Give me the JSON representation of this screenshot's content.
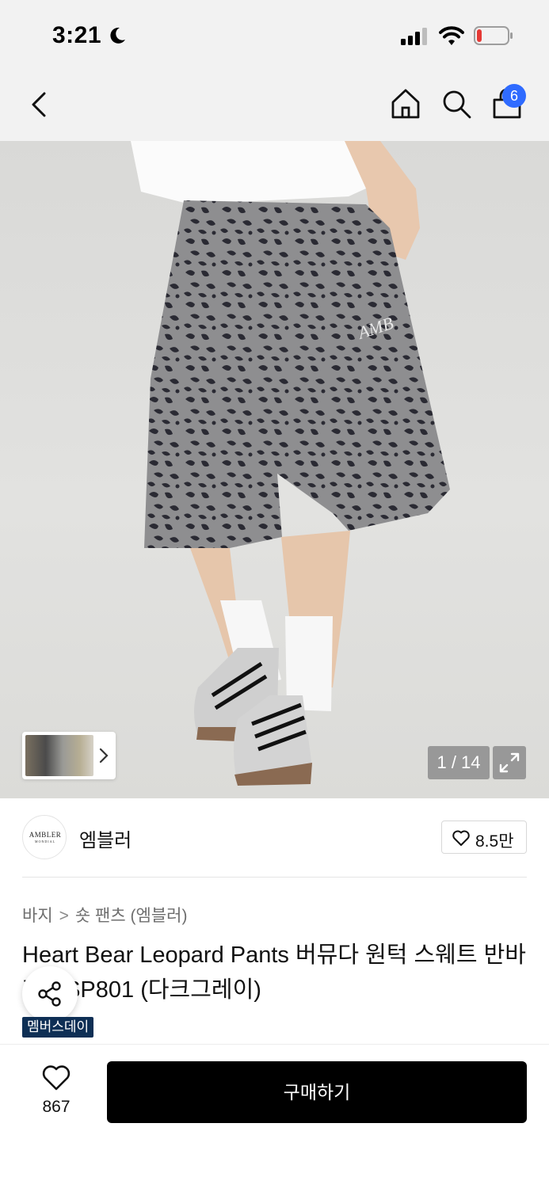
{
  "status_bar": {
    "time": "3:21",
    "icons": [
      "moon-icon",
      "signal-icon",
      "wifi-icon",
      "battery-low-icon"
    ],
    "battery_color": "#e53935"
  },
  "nav": {
    "icons": [
      "back-arrow-icon",
      "home-icon",
      "search-icon",
      "shopping-bag-icon"
    ],
    "cart_badge": "6",
    "badge_color": "#2f6bff"
  },
  "gallery": {
    "counter": "1 / 14",
    "thumb_icon": "chevron-right-icon",
    "expand_icon": "expand-icon"
  },
  "brand": {
    "logo_text": "AMBLER",
    "logo_sub": "MONDIAL",
    "name": "엠블러",
    "like_icon": "heart-outline-icon",
    "like_count": "8.5만"
  },
  "breadcrumb": {
    "items": [
      "바지",
      "숏 팬츠 (엠블러)"
    ],
    "separator": ">"
  },
  "product": {
    "title": "Heart Bear Leopard Pants 버뮤다 원턱 스웨트 반바지 ASP801 (다크그레이)",
    "tag": "멤버스데이",
    "tag_color": "#0e2f55"
  },
  "bottom_bar": {
    "wish_count": "867",
    "buy_label": "구매하기"
  }
}
